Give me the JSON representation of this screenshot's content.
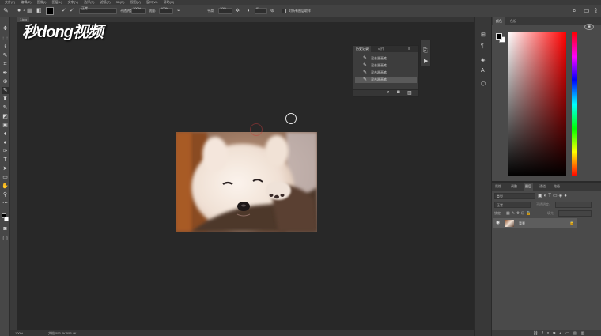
{
  "menu": [
    "文件(F)",
    "编辑(E)",
    "图像(I)",
    "图层(L)",
    "文字(Y)",
    "选择(S)",
    "滤镜(T)",
    "3D(D)",
    "视图(V)",
    "窗口(W)",
    "帮助(H)"
  ],
  "options": {
    "mode_label": "模式:",
    "mode_value": "正常",
    "opacity_label": "不透明度:",
    "opacity_value": "100%",
    "flow_label": "流量:",
    "flow_value": "100%",
    "smooth_label": "平滑:",
    "smooth_value": "10%",
    "angle_value": "0°",
    "checkbox_label": "对所有图层取样",
    "brush_size": "1"
  },
  "doc_tab": "1.jpg",
  "logo": "秒dong视频",
  "history": {
    "tabs": [
      "历史记录",
      "动作"
    ],
    "rows": [
      "混合器画笔",
      "混合器画笔",
      "混合器画笔",
      "混合器画笔"
    ]
  },
  "color_panel": {
    "tabs": [
      "颜色",
      "色板"
    ]
  },
  "layers_panel": {
    "tabs": [
      "属性",
      "调整",
      "图层",
      "通道",
      "路径"
    ],
    "filter_label": "类型",
    "blend_mode": "正常",
    "opacity_label": "不透明度:",
    "lock_label": "锁定:",
    "fill_label": "填充:",
    "layer_name": "背景"
  },
  "status": {
    "zoom": "100%",
    "doc_info": "文档:553.4K/553.4K"
  },
  "colors": {
    "foreground": "#000000",
    "background": "#ffffff",
    "accent": "#e21b1b"
  },
  "icons": {
    "tool_move": "move-icon",
    "tool_marquee": "marquee-icon",
    "tool_lasso": "lasso-icon",
    "tool_brush": "mixer-brush-icon",
    "search": "search-icon",
    "workspace": "workspace-icon",
    "share": "share-icon"
  }
}
